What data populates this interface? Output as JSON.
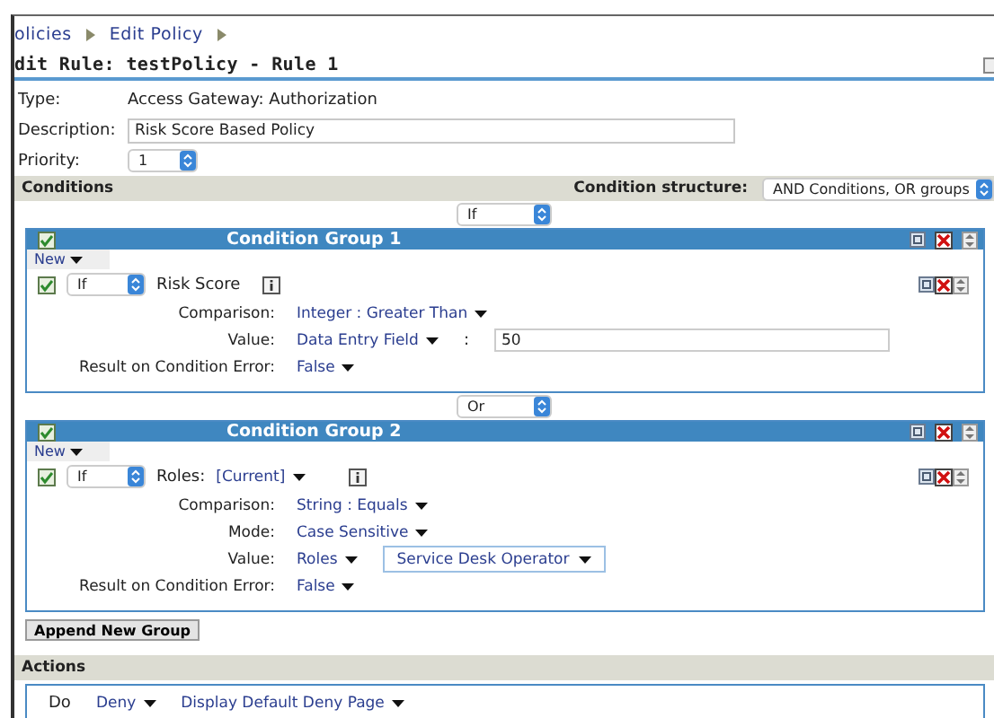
{
  "breadcrumb": [
    "olicies",
    "Edit Policy"
  ],
  "title": "dit Rule: testPolicy - Rule 1",
  "properties": [
    {
      "label": "Type:",
      "value": "Access Gateway: Authorization",
      "kind": "text"
    },
    {
      "label": "Description:",
      "value": "Risk Score Based Policy",
      "kind": "input"
    },
    {
      "label": "Priority:",
      "value": "1",
      "kind": "select"
    }
  ],
  "conditions": {
    "header": "Conditions",
    "structure_label": "Condition structure:",
    "structure_value": "AND Conditions, OR groups",
    "groups": [
      {
        "join": "If",
        "title": "Condition Group 1",
        "checked": true,
        "new_label": "New",
        "items": [
          {
            "checked": true,
            "operator": "If",
            "name": "Risk Score",
            "fields": [
              {
                "label": "Comparison:",
                "parts": [
                  {
                    "kind": "dropdown",
                    "text": "Integer : Greater Than"
                  }
                ]
              },
              {
                "label": "Value:",
                "parts": [
                  {
                    "kind": "dropdown",
                    "text": "Data Entry Field"
                  },
                  {
                    "kind": "colon",
                    "text": ":"
                  },
                  {
                    "kind": "input",
                    "text": "50"
                  }
                ]
              },
              {
                "label": "Result on Condition Error:",
                "parts": [
                  {
                    "kind": "dropdown",
                    "text": "False"
                  }
                ]
              }
            ]
          }
        ]
      },
      {
        "join": "Or",
        "title": "Condition Group 2",
        "checked": true,
        "new_label": "New",
        "items": [
          {
            "checked": true,
            "operator": "If",
            "name": "Roles:",
            "name_value": "[Current]",
            "fields": [
              {
                "label": "Comparison:",
                "parts": [
                  {
                    "kind": "dropdown",
                    "text": "String : Equals"
                  }
                ]
              },
              {
                "label": "Mode:",
                "parts": [
                  {
                    "kind": "dropdown",
                    "text": "Case Sensitive"
                  }
                ]
              },
              {
                "label": "Value:",
                "parts": [
                  {
                    "kind": "dropdown",
                    "text": "Roles"
                  },
                  {
                    "kind": "boxed",
                    "text": "Service Desk Operator"
                  }
                ]
              },
              {
                "label": "Result on Condition Error:",
                "parts": [
                  {
                    "kind": "dropdown",
                    "text": "False"
                  }
                ]
              }
            ]
          }
        ]
      }
    ],
    "append_button": "Append New Group"
  },
  "actions": {
    "header": "Actions",
    "do_label": "Do",
    "dropdowns": [
      "Deny",
      "Display Default Deny Page"
    ]
  }
}
